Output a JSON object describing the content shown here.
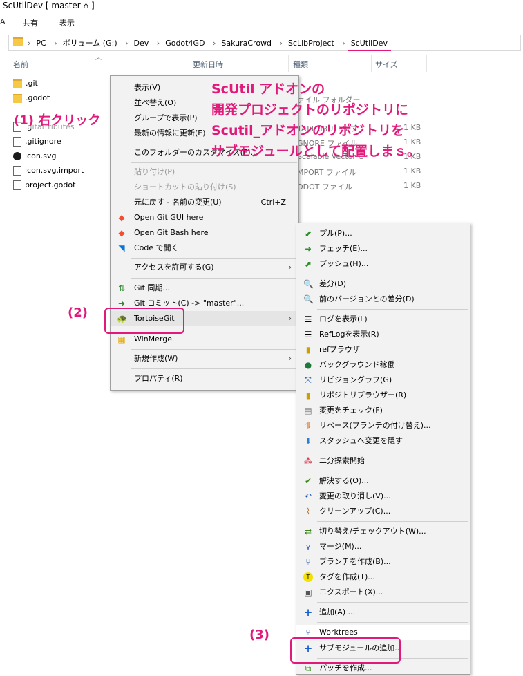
{
  "window": {
    "title": "ScUtilDev [ master ⌂ ]"
  },
  "ribbon": {
    "tabs": [
      "A",
      "共有",
      "表示"
    ]
  },
  "address": {
    "crumbs": [
      "PC",
      "ボリューム (G:)",
      "Dev",
      "Godot4GD",
      "SakuraCrowd",
      "ScLibProject",
      "ScUtilDev"
    ]
  },
  "columns": {
    "name": "名前",
    "modified": "更新日時",
    "type": "種類",
    "size": "サイズ"
  },
  "files": [
    {
      "name": ".git",
      "icon": "folder-icon"
    },
    {
      "name": ".godot",
      "icon": "folder-icon"
    },
    {
      "name": ".gitattributes",
      "icon": "file-icon"
    },
    {
      "name": ".gitignore",
      "icon": "file-icon"
    },
    {
      "name": "icon.svg",
      "icon": "godot-icon"
    },
    {
      "name": "icon.svg.import",
      "icon": "file-icon"
    },
    {
      "name": "project.godot",
      "icon": "file-icon"
    }
  ],
  "background_columns": {
    "types": [
      "ァイル フォルダー",
      "TATTRIBUTES フ",
      "GNORE ファイル",
      "Scalable Vector Gr",
      "MPORT ファイル",
      "ODOT ファイル"
    ],
    "sizes": [
      "1 KB",
      "1 KB",
      "1 KB",
      "1 KB",
      "1 KB"
    ]
  },
  "context_menu": {
    "items": [
      {
        "label": "表示(V)",
        "icon": ""
      },
      {
        "label": "並べ替え(O)",
        "icon": ""
      },
      {
        "label": "グループで表示(P)",
        "icon": ""
      },
      {
        "label": "最新の情報に更新(E)",
        "icon": ""
      },
      {
        "label": "このフォルダーのカスタマイズ(F)...",
        "icon": ""
      },
      {
        "label": "貼り付け(P)",
        "icon": ""
      },
      {
        "label": "ショートカットの貼り付け(S)",
        "icon": ""
      },
      {
        "label": "元に戻す - 名前の変更(U)",
        "shortcut": "Ctrl+Z"
      },
      {
        "label": "Open Git GUI here",
        "icon": "git-gui-icon"
      },
      {
        "label": "Open Git Bash here",
        "icon": "git-bash-icon"
      },
      {
        "label": "Code で開く",
        "icon": "vscode-icon"
      },
      {
        "label": "アクセスを許可する(G)",
        "icon": ""
      },
      {
        "label": "Git 同期...",
        "icon": "git-sync-icon"
      },
      {
        "label": "Git コミット(C) -> \"master\"...",
        "icon": "git-commit-icon"
      },
      {
        "label": "TortoiseGit",
        "icon": "tortoisegit-icon"
      },
      {
        "label": "WinMerge",
        "icon": "winmerge-icon"
      },
      {
        "label": "新規作成(W)",
        "icon": ""
      },
      {
        "label": "プロパティ(R)",
        "icon": ""
      }
    ]
  },
  "tortoisegit_menu": {
    "items": [
      {
        "label": "プル(P)...",
        "icon": "pull-icon"
      },
      {
        "label": "フェッチ(E)...",
        "icon": "fetch-icon"
      },
      {
        "label": "プッシュ(H)...",
        "icon": "push-icon"
      },
      {
        "label": "差分(D)",
        "icon": "diff-icon"
      },
      {
        "label": "前のバージョンとの差分(D)",
        "icon": "diff-prev-icon"
      },
      {
        "label": "ログを表示(L)",
        "icon": "log-icon"
      },
      {
        "label": "RefLogを表示(R)",
        "icon": "reflog-icon"
      },
      {
        "label": "refブラウザ",
        "icon": "ref-browser-icon"
      },
      {
        "label": "バックグラウンド稼働",
        "icon": "globe-icon"
      },
      {
        "label": "リビジョングラフ(G)",
        "icon": "revision-graph-icon"
      },
      {
        "label": "リポジトリブラウザー(R)",
        "icon": "repo-browser-icon"
      },
      {
        "label": "変更をチェック(F)",
        "icon": "check-changes-icon"
      },
      {
        "label": "リベース(ブランチの付け替え)...",
        "icon": "rebase-icon"
      },
      {
        "label": "スタッシュへ変更を隠す",
        "icon": "stash-icon"
      },
      {
        "label": "二分探索開始",
        "icon": "bisect-icon"
      },
      {
        "label": "解決する(O)...",
        "icon": "resolve-icon"
      },
      {
        "label": "変更の取り消し(V)...",
        "icon": "revert-icon"
      },
      {
        "label": "クリーンアップ(C)...",
        "icon": "cleanup-icon"
      },
      {
        "label": "切り替え/チェックアウト(W)...",
        "icon": "switch-icon"
      },
      {
        "label": "マージ(M)...",
        "icon": "merge-icon"
      },
      {
        "label": "ブランチを作成(B)...",
        "icon": "branch-icon"
      },
      {
        "label": "タグを作成(T)...",
        "icon": "tag-icon"
      },
      {
        "label": "エクスポート(X)...",
        "icon": "export-icon"
      },
      {
        "label": "追加(A) ...",
        "icon": "add-icon"
      },
      {
        "label": "Worktrees",
        "icon": "worktrees-icon"
      },
      {
        "label": "サブモジュールの追加...",
        "icon": "add-icon"
      },
      {
        "label": "パッチを作成...",
        "icon": "patch-icon"
      }
    ]
  },
  "annotations": {
    "step1": "(1) 右クリック",
    "step2": "(2)",
    "step3": "(3)",
    "explanation": [
      "ScUtil アドオンの",
      "開発プロジェクトのリポジトリに",
      "Scutil_アドオンのリポジトリを",
      "サブモジュールとして配置しまｓ。"
    ]
  },
  "colors": {
    "annotation": "#e0197a"
  }
}
